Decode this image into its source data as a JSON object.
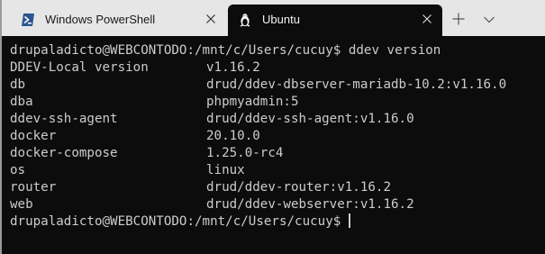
{
  "tabs": [
    {
      "label": "Windows PowerShell",
      "icon": "powershell-icon",
      "active": false
    },
    {
      "label": "Ubuntu",
      "icon": "linux-tux-icon",
      "active": true
    }
  ],
  "tabbar": {
    "new_tab_icon": "plus-icon",
    "dropdown_icon": "chevron-down-icon"
  },
  "terminal": {
    "prompt": "drupaladicto@WEBCONTODO:/mnt/c/Users/cucuy$",
    "command": "ddev version",
    "rows": [
      {
        "key": "DDEV-Local version",
        "value": "v1.16.2"
      },
      {
        "key": "db",
        "value": "drud/ddev-dbserver-mariadb-10.2:v1.16.0"
      },
      {
        "key": "dba",
        "value": "phpmyadmin:5"
      },
      {
        "key": "ddev-ssh-agent",
        "value": "drud/ddev-ssh-agent:v1.16.0"
      },
      {
        "key": "docker",
        "value": "20.10.0"
      },
      {
        "key": "docker-compose",
        "value": "1.25.0-rc4"
      },
      {
        "key": "os",
        "value": "linux"
      },
      {
        "key": "router",
        "value": "drud/ddev-router:v1.16.2"
      },
      {
        "key": "web",
        "value": "drud/ddev-webserver:v1.16.2"
      }
    ],
    "final_prompt": "drupaladicto@WEBCONTODO:/mnt/c/Users/cucuy$"
  },
  "colors": {
    "tabbar_bg": "#e6e6e6",
    "terminal_bg": "#0c0c0c",
    "terminal_text": "#cccccc"
  }
}
